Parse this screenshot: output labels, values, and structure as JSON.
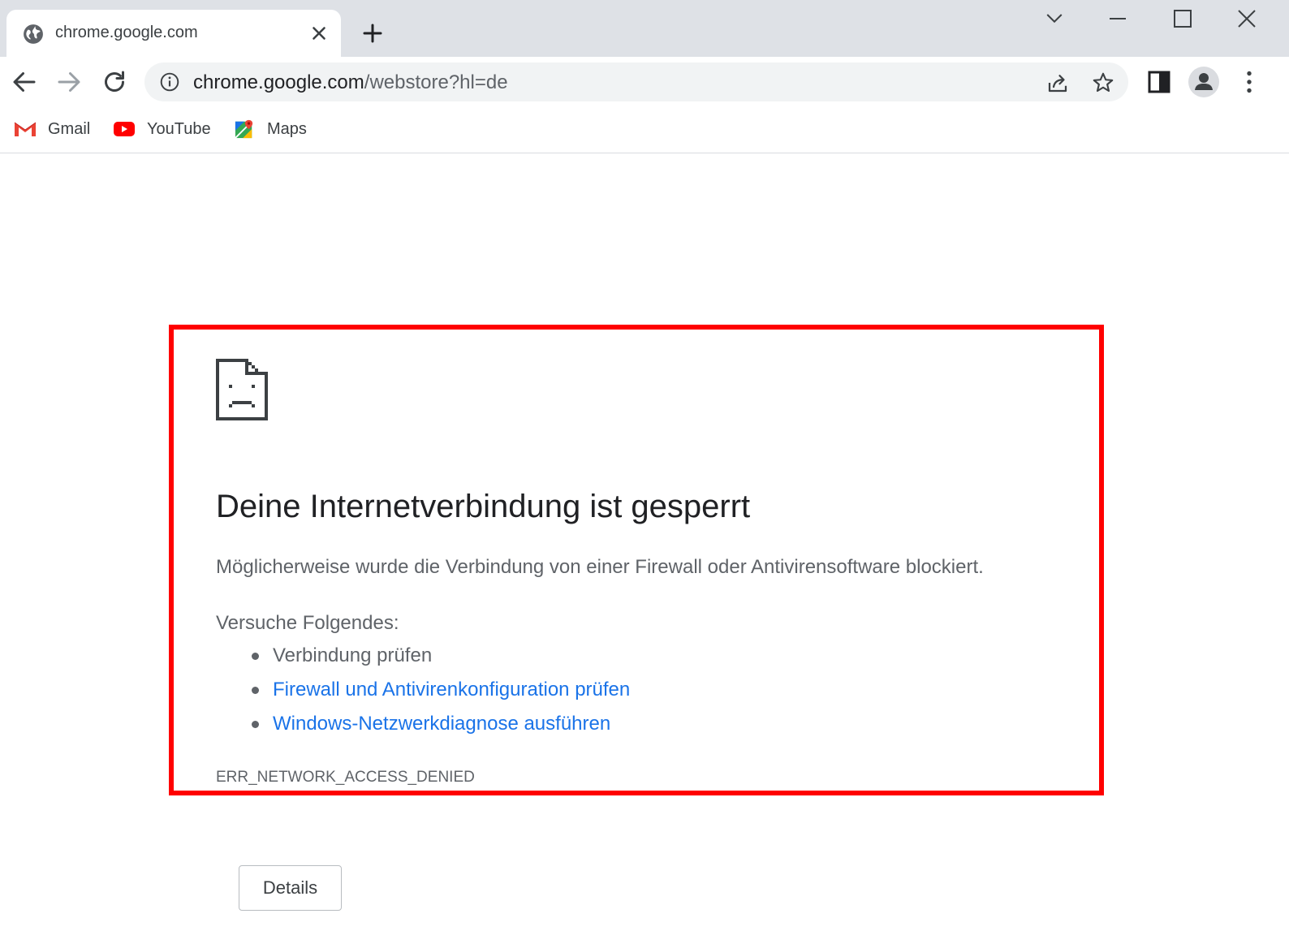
{
  "tab": {
    "title": "chrome.google.com",
    "favicon": "globe-icon"
  },
  "omnibox": {
    "url_host": "chrome.google.com",
    "url_path": "/webstore?hl=de"
  },
  "bookmarks": [
    {
      "label": "Gmail",
      "icon": "gmail-icon"
    },
    {
      "label": "YouTube",
      "icon": "youtube-icon"
    },
    {
      "label": "Maps",
      "icon": "maps-icon"
    }
  ],
  "error": {
    "title": "Deine Internetverbindung ist gesperrt",
    "description": "Möglicherweise wurde die Verbindung von einer Firewall oder Antivirensoftware blockiert.",
    "try_heading": "Versuche Folgendes:",
    "suggestions": [
      {
        "text": "Verbindung prüfen",
        "link": false
      },
      {
        "text": "Firewall und Antivirenkonfiguration prüfen",
        "link": true
      },
      {
        "text": "Windows-Netzwerkdiagnose ausführen",
        "link": true
      }
    ],
    "code": "ERR_NETWORK_ACCESS_DENIED",
    "details_label": "Details"
  },
  "colors": {
    "tabstrip": "#dee1e6",
    "omnibox": "#f1f3f4",
    "link": "#1a73e8",
    "highlight": "#ff0000"
  }
}
